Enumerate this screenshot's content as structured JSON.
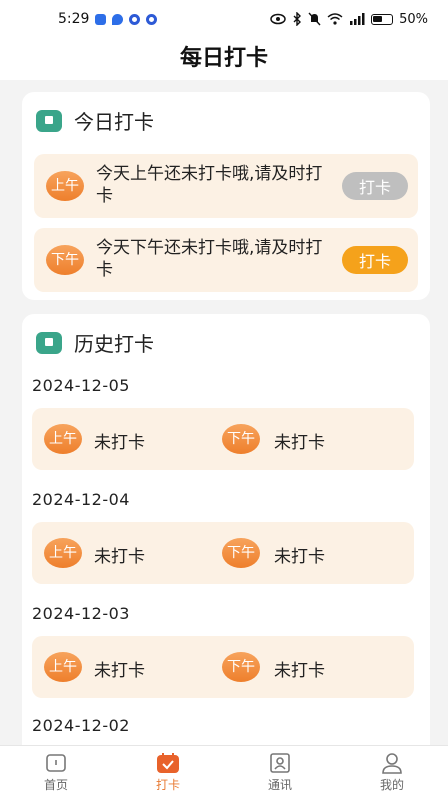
{
  "status_bar": {
    "time": "5:29",
    "battery": "50%"
  },
  "header": {
    "title": "每日打卡"
  },
  "today": {
    "title": "今日打卡",
    "am": {
      "badge": "上午",
      "text": "今天上午还未打卡哦,请及时打卡",
      "button": "打卡"
    },
    "pm": {
      "badge": "下午",
      "text": "今天下午还未打卡哦,请及时打卡",
      "button": "打卡"
    }
  },
  "history": {
    "title": "历史打卡",
    "am_badge": "上午",
    "pm_badge": "下午",
    "entries": [
      {
        "date": "2024-12-05",
        "am_status": "未打卡",
        "pm_status": "未打卡"
      },
      {
        "date": "2024-12-04",
        "am_status": "未打卡",
        "pm_status": "未打卡"
      },
      {
        "date": "2024-12-03",
        "am_status": "未打卡",
        "pm_status": "未打卡"
      },
      {
        "date": "2024-12-02"
      }
    ]
  },
  "nav": {
    "items": [
      {
        "label": "首页",
        "icon": "home-icon"
      },
      {
        "label": "打卡",
        "icon": "calendar-check-icon"
      },
      {
        "label": "通讯",
        "icon": "contacts-icon"
      },
      {
        "label": "我的",
        "icon": "user-icon"
      }
    ],
    "active_color": "#e87a33"
  },
  "colors": {
    "accent_orange": "#f5a21b",
    "badge_orange": "#ee7f2c",
    "row_background": "#fcf1e4",
    "title_icon_green": "#3aa58a",
    "disabled_button": "#bfbfbf"
  }
}
